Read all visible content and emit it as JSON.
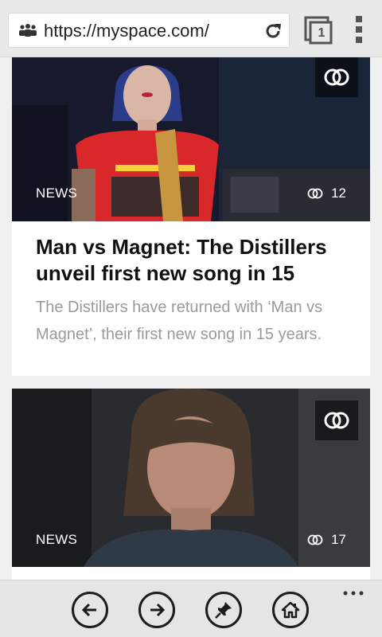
{
  "browser": {
    "url": "https://myspace.com/",
    "tab_count": "1",
    "icons": {
      "site": "site-people-icon",
      "refresh": "refresh-icon",
      "tabs": "tabs-icon",
      "menu": "vertical-dots-icon"
    }
  },
  "feed": {
    "cards": [
      {
        "tag": "NEWS",
        "connections": "12",
        "headline": "Man vs Magnet: The Distillers unveil first new song in 15",
        "summary": "The Distillers have returned with ‘Man vs Magnet’, their first new song in 15 years."
      },
      {
        "tag": "NEWS",
        "connections": "17"
      }
    ]
  },
  "appbar": {
    "buttons": [
      "back-icon",
      "forward-icon",
      "pin-icon",
      "home-icon"
    ],
    "more": "more-dots-icon"
  },
  "colors": {
    "chrome": "#e9e9e9",
    "card_bg": "#ffffff",
    "headline": "#111111",
    "summary": "#9a9a9a"
  }
}
